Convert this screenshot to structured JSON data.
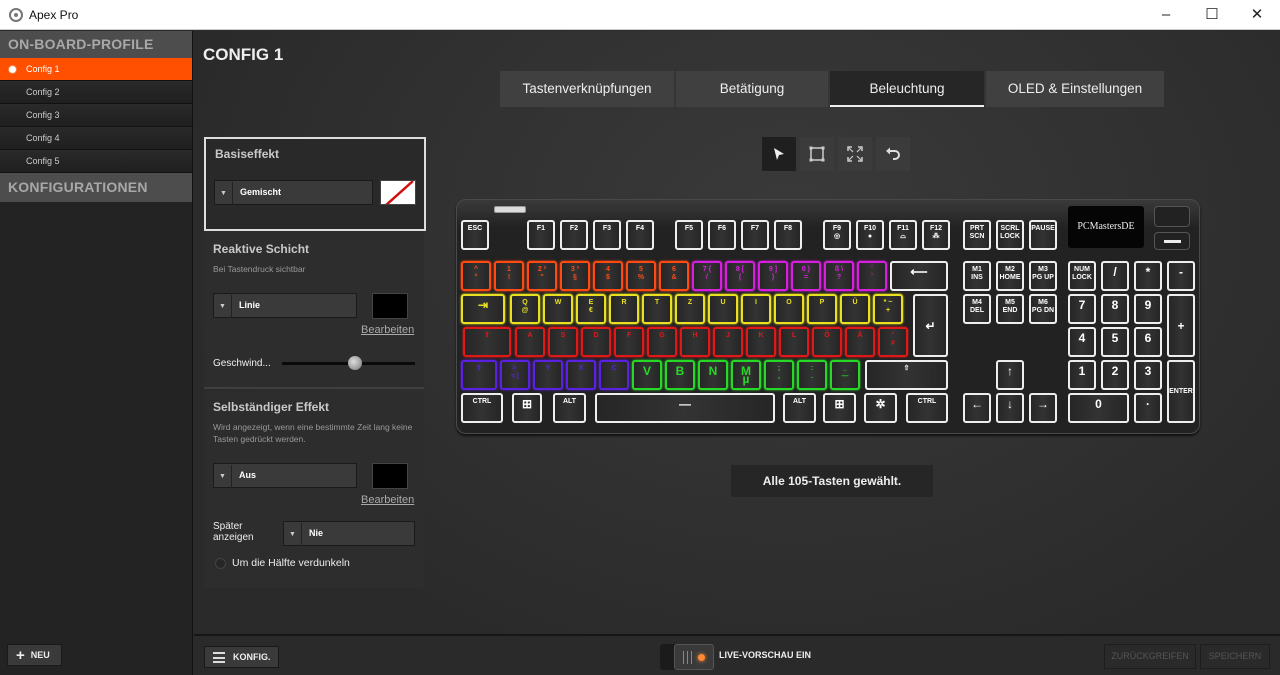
{
  "window": {
    "title": "Apex Pro",
    "controls": {
      "minimize": "–",
      "maximize": "☐",
      "close": "✕"
    }
  },
  "sidebar": {
    "onboard_header": "ON-BOARD-PROFILE",
    "configs": [
      {
        "label": "Config 1",
        "active": true
      },
      {
        "label": "Config 2",
        "active": false
      },
      {
        "label": "Config 3",
        "active": false
      },
      {
        "label": "Config 4",
        "active": false
      },
      {
        "label": "Config 5",
        "active": false
      }
    ],
    "configs_header": "KONFIGURATIONEN",
    "new_button": "NEU"
  },
  "main": {
    "title": "CONFIG 1",
    "tabs": [
      {
        "label": "Tastenverknüpfungen",
        "active": false
      },
      {
        "label": "Betätigung",
        "active": false
      },
      {
        "label": "Beleuchtung",
        "active": true
      },
      {
        "label": "OLED & Einstellungen",
        "active": false
      }
    ],
    "tools": [
      "select-pointer-icon",
      "rectangle-select-icon",
      "select-all-icon",
      "undo-icon"
    ],
    "base_effect": {
      "title": "Basiseffekt",
      "dropdown": "Gemischt",
      "color": "none"
    },
    "reactive_layer": {
      "title": "Reaktive Schicht",
      "subtitle": "Bei Tastendruck sichtbar",
      "dropdown": "Linie",
      "color": "#000000",
      "edit_link": "Bearbeiten",
      "speed_label": "Geschwind...",
      "speed_value": 0.55
    },
    "standalone_effect": {
      "title": "Selbständiger Effekt",
      "subtitle": "Wird angezeigt, wenn eine bestimmte Zeit lang keine Tasten gedrückt werden.",
      "dropdown": "Aus",
      "color": "#000000",
      "edit_link": "Bearbeiten",
      "later_label": "Später anzeigen",
      "later_dropdown": "Nie",
      "dim_label": "Um die Hälfte verdunkeln",
      "dim_checked": false
    },
    "keyboard": {
      "oled_text": "PCMastersDE",
      "colors": {
        "white": "#eeeeee",
        "orange": "#ff4a12",
        "magenta": "#d81fe0",
        "yellow": "#e8e020",
        "red": "#e01818",
        "purple": "#5a22e0",
        "green": "#28d828"
      }
    },
    "status": "Alle 105-Tasten gewählt."
  },
  "footer": {
    "konfig_button": "KONFIG.",
    "live_preview": "LIVE-VORSCHAU EIN",
    "live_preview_on": true,
    "revert_button": "ZURÜCKGREIFEN",
    "save_button": "SPEICHERN"
  },
  "accent_color": "#fe5000"
}
